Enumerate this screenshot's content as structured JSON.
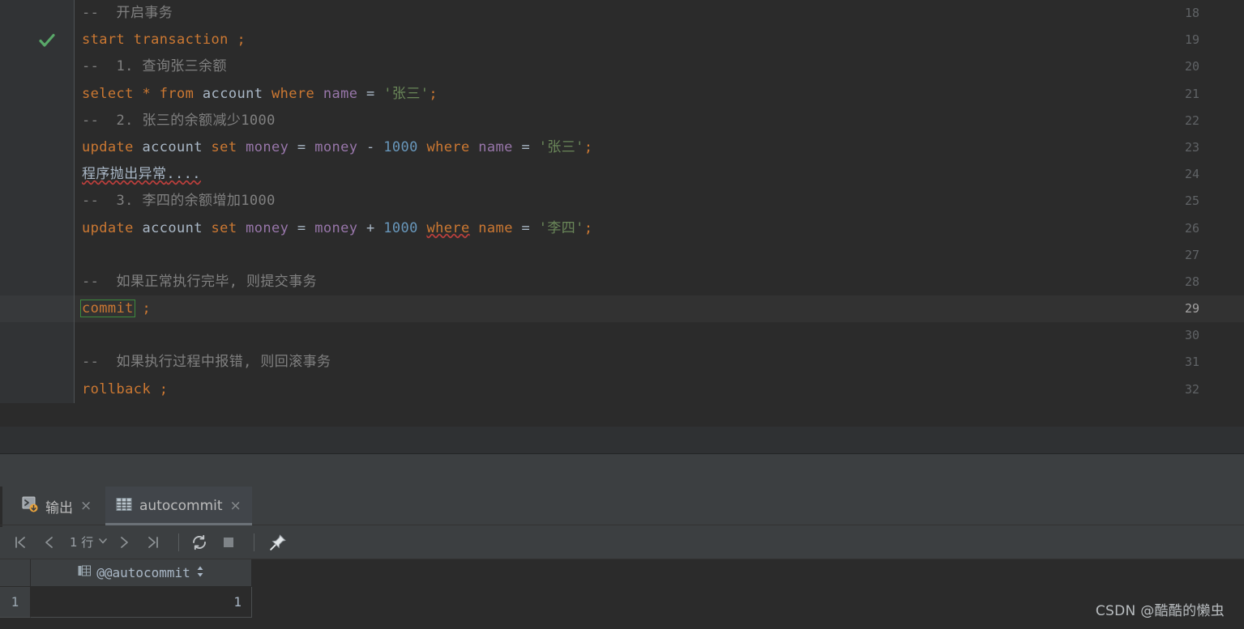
{
  "editor": {
    "lines": [
      {
        "no": "18",
        "marker": "",
        "current": false,
        "tokens": [
          {
            "t": "--  开启事务",
            "c": "cmt"
          }
        ]
      },
      {
        "no": "19",
        "marker": "check-icon",
        "current": false,
        "tokens": [
          {
            "t": "start transaction ",
            "c": "kw"
          },
          {
            "t": ";",
            "c": "kw"
          }
        ]
      },
      {
        "no": "20",
        "marker": "",
        "current": false,
        "tokens": [
          {
            "t": "--  1. 查询张三余额",
            "c": "cmt"
          }
        ]
      },
      {
        "no": "21",
        "marker": "",
        "current": false,
        "tokens": [
          {
            "t": "select ",
            "c": "kw"
          },
          {
            "t": "* ",
            "c": "kw"
          },
          {
            "t": "from ",
            "c": "kw"
          },
          {
            "t": "account ",
            "c": "id"
          },
          {
            "t": "where ",
            "c": "kw"
          },
          {
            "t": "name ",
            "c": "var"
          },
          {
            "t": "= ",
            "c": "op"
          },
          {
            "t": "'张三'",
            "c": "str"
          },
          {
            "t": ";",
            "c": "kw"
          }
        ]
      },
      {
        "no": "22",
        "marker": "",
        "current": false,
        "tokens": [
          {
            "t": "--  2. 张三的余额减少1000",
            "c": "cmt"
          }
        ]
      },
      {
        "no": "23",
        "marker": "",
        "current": false,
        "tokens": [
          {
            "t": "update ",
            "c": "kw"
          },
          {
            "t": "account ",
            "c": "id"
          },
          {
            "t": "set ",
            "c": "kw"
          },
          {
            "t": "money ",
            "c": "var"
          },
          {
            "t": "= ",
            "c": "op"
          },
          {
            "t": "money ",
            "c": "var"
          },
          {
            "t": "- ",
            "c": "op"
          },
          {
            "t": "1000 ",
            "c": "num"
          },
          {
            "t": "where ",
            "c": "kw"
          },
          {
            "t": "name ",
            "c": "var"
          },
          {
            "t": "= ",
            "c": "op"
          },
          {
            "t": "'张三'",
            "c": "str"
          },
          {
            "t": ";",
            "c": "kw"
          }
        ]
      },
      {
        "no": "24",
        "marker": "",
        "current": false,
        "tokens": [
          {
            "t": "程序抛出异常",
            "c": "id err"
          },
          {
            "t": "....",
            "c": "id err"
          }
        ]
      },
      {
        "no": "25",
        "marker": "",
        "current": false,
        "tokens": [
          {
            "t": "--  3. 李四的余额增加1000",
            "c": "cmt"
          }
        ]
      },
      {
        "no": "26",
        "marker": "",
        "current": false,
        "tokens": [
          {
            "t": "update ",
            "c": "kw"
          },
          {
            "t": "account ",
            "c": "id"
          },
          {
            "t": "set ",
            "c": "kw"
          },
          {
            "t": "money ",
            "c": "var"
          },
          {
            "t": "= ",
            "c": "op"
          },
          {
            "t": "money ",
            "c": "var"
          },
          {
            "t": "+ ",
            "c": "op"
          },
          {
            "t": "1000 ",
            "c": "num"
          },
          {
            "t": "where",
            "c": "kw err"
          },
          {
            "t": " name ",
            "c": "kw"
          },
          {
            "t": "= ",
            "c": "op"
          },
          {
            "t": "'李四'",
            "c": "str"
          },
          {
            "t": ";",
            "c": "kw"
          }
        ]
      },
      {
        "no": "27",
        "marker": "",
        "current": false,
        "tokens": []
      },
      {
        "no": "28",
        "marker": "",
        "current": false,
        "tokens": [
          {
            "t": "--  如果正常执行完毕, 则提交事务",
            "c": "cmt"
          }
        ]
      },
      {
        "no": "29",
        "marker": "",
        "current": true,
        "tokens": [
          {
            "t": "commit",
            "c": "kw",
            "box": true
          },
          {
            "t": " ;",
            "c": "kw"
          }
        ]
      },
      {
        "no": "30",
        "marker": "",
        "current": false,
        "tokens": []
      },
      {
        "no": "31",
        "marker": "",
        "current": false,
        "tokens": [
          {
            "t": "--  如果执行过程中报错, 则回滚事务",
            "c": "cmt"
          }
        ]
      },
      {
        "no": "32",
        "marker": "",
        "current": false,
        "tokens": [
          {
            "t": "rollback ",
            "c": "kw"
          },
          {
            "t": ";",
            "c": "kw"
          }
        ]
      }
    ]
  },
  "panel": {
    "tabs": [
      {
        "label": "输出",
        "icon": "console-output-icon",
        "selected": false,
        "close": "×"
      },
      {
        "label": "autocommit",
        "icon": "table-grid-icon",
        "selected": true,
        "close": "×"
      }
    ],
    "toolbar": {
      "first_page": "first-page-icon",
      "prev_page": "prev-page-icon",
      "row_count": "1 行",
      "dropdown": "chevron-down-icon",
      "next_page": "next-page-icon",
      "last_page": "last-page-icon",
      "refresh": "refresh-icon",
      "stop": "stop-icon",
      "pin": "pin-icon"
    },
    "grid": {
      "columns": [
        "@@autocommit"
      ],
      "column_icon": "column-type-icon",
      "sort_indicator": "sort-updown-icon",
      "rows": [
        {
          "num": "1",
          "cells": [
            "1"
          ]
        }
      ]
    }
  },
  "watermark": {
    "text": "CSDN @酷酷的懒虫"
  },
  "colors": {
    "editor_bg": "#2b2b2b",
    "gutter_bg": "#313335",
    "current_line_bg": "#323232",
    "panel_bg": "#3c3f41",
    "keyword": "#cc7832",
    "identifier": "#a9b7c6",
    "variable": "#9876aa",
    "number": "#6897bb",
    "string": "#6a8759",
    "comment": "#808080",
    "error_squiggle": "#bc3f3c",
    "selection_box": "#3d8b3d",
    "checkmark": "#59a869"
  }
}
